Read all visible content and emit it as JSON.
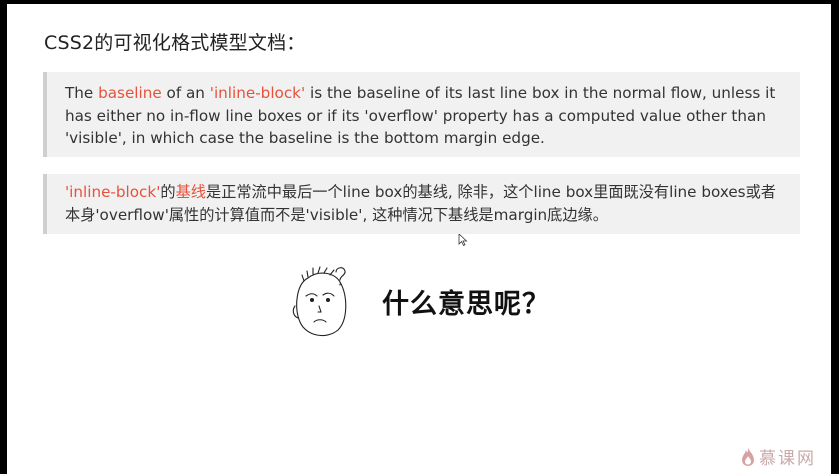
{
  "slide": {
    "title": "CSS2的可视化格式模型文档："
  },
  "quote_en": {
    "t1": "The ",
    "t2": "baseline",
    "t3": " of an ",
    "t4": "'inline-block'",
    "t5": " is the baseline of its last line box in the normal flow, unless it has either no in-flow line boxes or if its 'overflow' property has a computed value other than 'visible', in which case the baseline is the bottom margin edge."
  },
  "quote_cn": {
    "t1": "'inline-block'",
    "t2": "的",
    "t3": "基线",
    "t4": "是正常流中最后一个line box的基线, 除非，这个line box里面既没有line boxes或者本身'overflow'属性的计算值而不是'visible', 这种情况下基线是margin底边缘。"
  },
  "question": "什么意思呢？",
  "icons": {
    "face": "confused-face-illustration",
    "cursor": "mouse-cursor-icon",
    "logo": "flame-logo-icon"
  },
  "logo": {
    "text": "慕课网"
  },
  "colors": {
    "highlight": "#e5533d",
    "quote_bg": "#f1f1f1",
    "quote_border": "#cfcfcf"
  }
}
